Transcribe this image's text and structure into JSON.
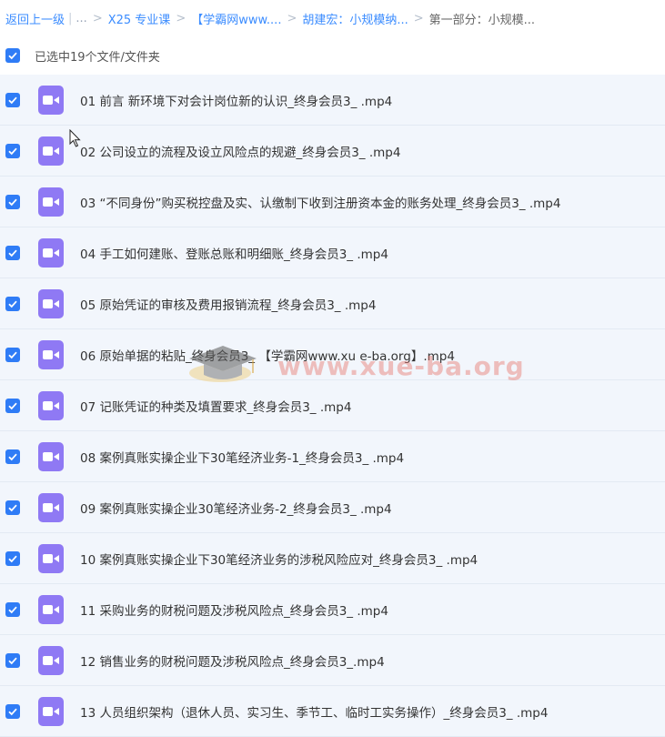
{
  "breadcrumb": {
    "back": "返回上一级",
    "ellipsis": "...",
    "items": [
      "X25 专业课",
      "【学霸网www....",
      "胡建宏：小规模纳...",
      "第一部分：小规模..."
    ]
  },
  "selection": {
    "label": "已选中19个文件/文件夹"
  },
  "files": [
    "01 前言 新环境下对会计岗位新的认识_终身会员3_ .mp4",
    "02 公司设立的流程及设立风险点的规避_终身会员3_ .mp4",
    "03 “不同身份”购买税控盘及实、认缴制下收到注册资本金的账务处理_终身会员3_ .mp4",
    "04 手工如何建账、登账总账和明细账_终身会员3_ .mp4",
    "05 原始凭证的审核及费用报销流程_终身会员3_ .mp4",
    "06 原始单据的粘贴_终身会员3_ 【学霸网www.xu e-ba.org】.mp4",
    "07 记账凭证的种类及填置要求_终身会员3_ .mp4",
    "08 案例真账实操企业下30笔经济业务-1_终身会员3_ .mp4",
    "09 案例真账实操企业30笔经济业务-2_终身会员3_ .mp4",
    "10 案例真账实操企业下30笔经济业务的涉税风险应对_终身会员3_ .mp4",
    "11 采购业务的财税问题及涉税风险点_终身会员3_ .mp4",
    "12 销售业务的财税问题及涉税风险点_终身会员3_.mp4",
    "13 人员组织架构（退休人员、实习生、季节工、临时工实务操作）_终身会员3_ .mp4"
  ],
  "watermark": {
    "text": "www.xue-ba.org"
  },
  "colors": {
    "accent": "#2f7cf6",
    "video_icon": "#8f79f4",
    "row_bg": "#f2f6fc"
  },
  "icons": {
    "checkbox": "checkmark-icon",
    "file": "video-file-icon"
  }
}
